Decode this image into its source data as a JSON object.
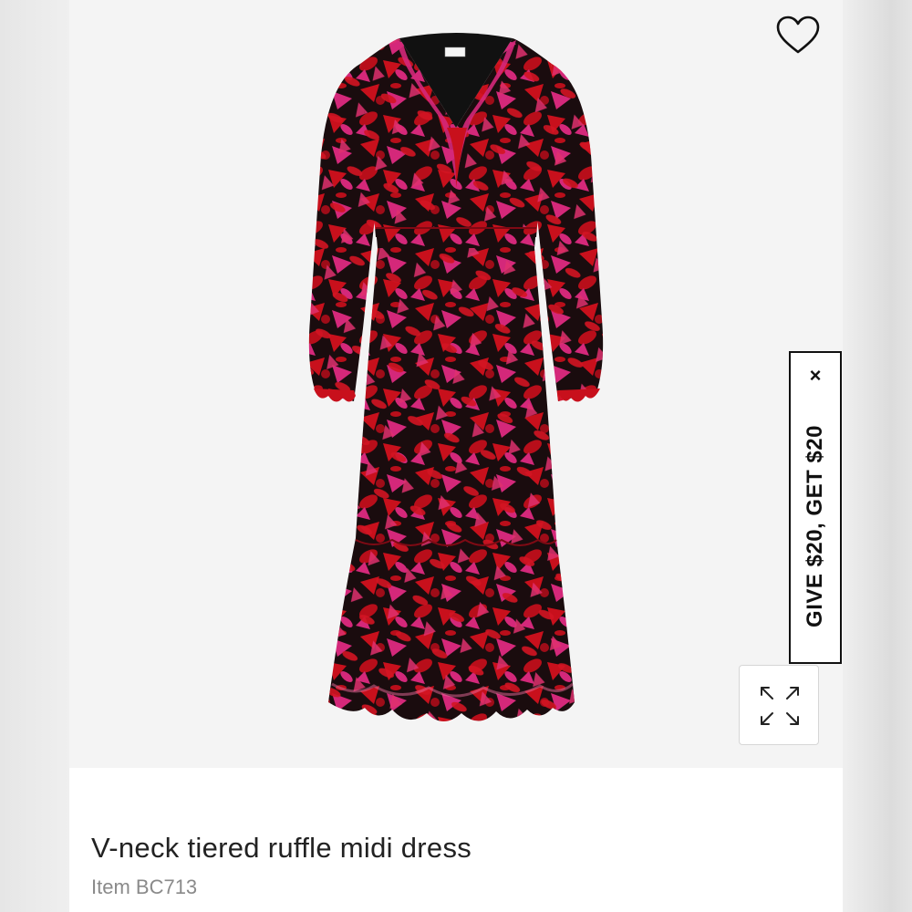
{
  "product": {
    "title": "V-neck tiered ruffle midi dress",
    "item_number": "Item BC713",
    "image_alt": "Red and pink floral print long-sleeve V-neck tiered ruffle midi dress",
    "colors": {
      "base": "#1a0c0e",
      "red": "#c8101c",
      "magenta": "#d4287a"
    }
  },
  "wishlist": {
    "icon": "heart-outline-icon"
  },
  "referral": {
    "label": "GIVE $20, GET $20",
    "close_label": "×"
  },
  "expand": {
    "icon": "expand-arrows-icon"
  }
}
